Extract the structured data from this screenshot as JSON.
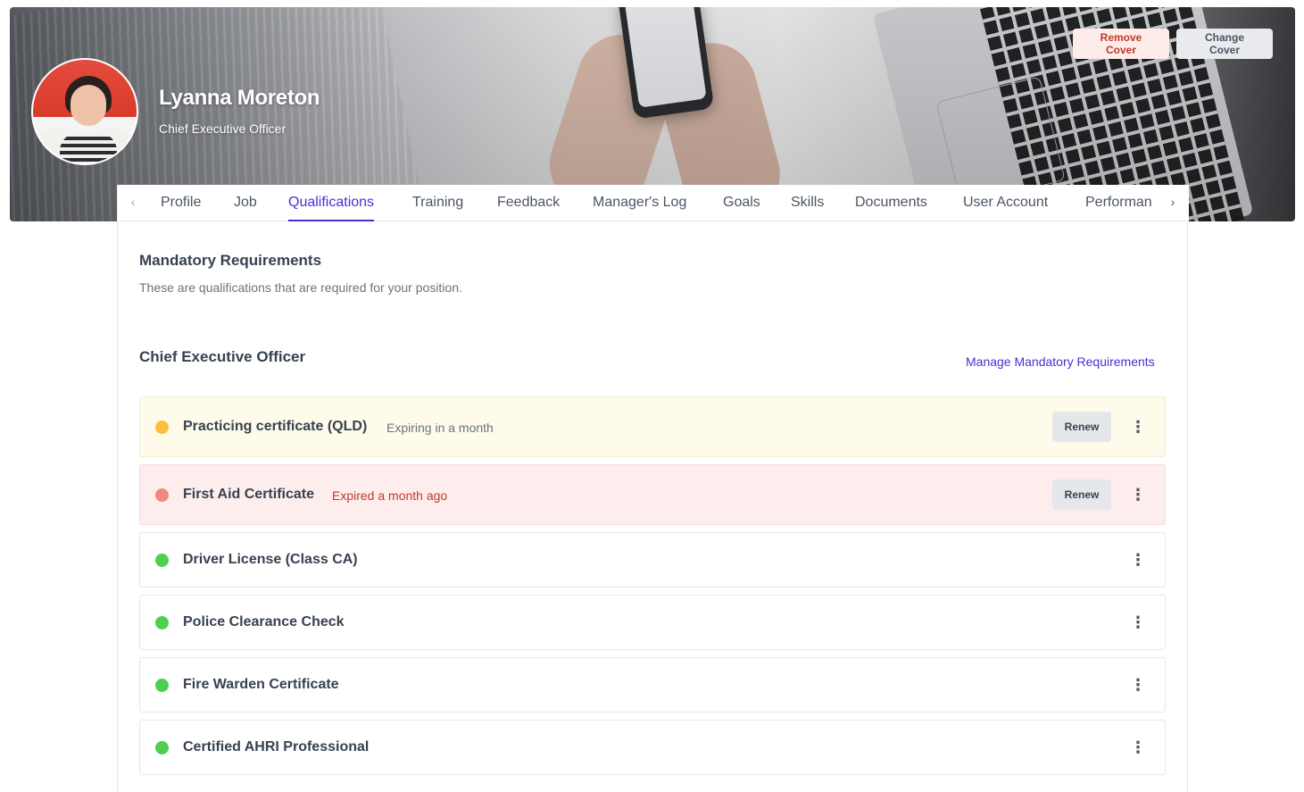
{
  "profile": {
    "name": "Lyanna Moreton",
    "title": "Chief Executive Officer"
  },
  "cover": {
    "remove_label": "Remove Cover",
    "change_label": "Change Cover"
  },
  "tabs": [
    {
      "label": "Profile"
    },
    {
      "label": "Job"
    },
    {
      "label": "Qualifications",
      "active": true
    },
    {
      "label": "Training"
    },
    {
      "label": "Feedback"
    },
    {
      "label": "Manager's Log"
    },
    {
      "label": "Goals"
    },
    {
      "label": "Skills"
    },
    {
      "label": "Documents"
    },
    {
      "label": "User Account"
    },
    {
      "label": "Performan"
    }
  ],
  "icons": {
    "tab_left": "chevron-left-icon",
    "tab_right": "chevron-right-icon",
    "menu": "more-vertical-icon"
  },
  "section": {
    "title": "Mandatory Requirements",
    "description": "These are qualifications that are required for your position."
  },
  "position": {
    "title": "Chief Executive Officer",
    "manage_link": "Manage Mandatory Requirements"
  },
  "qualifications": [
    {
      "name": "Practicing certificate (QLD)",
      "status": "Expiring in a month",
      "state": "warning",
      "action": "Renew"
    },
    {
      "name": "First Aid Certificate",
      "status": "Expired a month ago",
      "state": "expired",
      "action": "Renew"
    },
    {
      "name": "Driver License (Class CA)",
      "state": "valid"
    },
    {
      "name": "Police Clearance Check",
      "state": "valid"
    },
    {
      "name": "Fire Warden Certificate",
      "state": "valid"
    },
    {
      "name": "Certified AHRI Professional",
      "state": "valid"
    }
  ],
  "colors": {
    "accent": "#4f2bd8",
    "warning_dot": "#fbbf3c",
    "expired_dot": "#f08a80",
    "valid_dot": "#4fcf4f",
    "expiring_text": "#6b7280",
    "expired_text": "#c0392b"
  }
}
